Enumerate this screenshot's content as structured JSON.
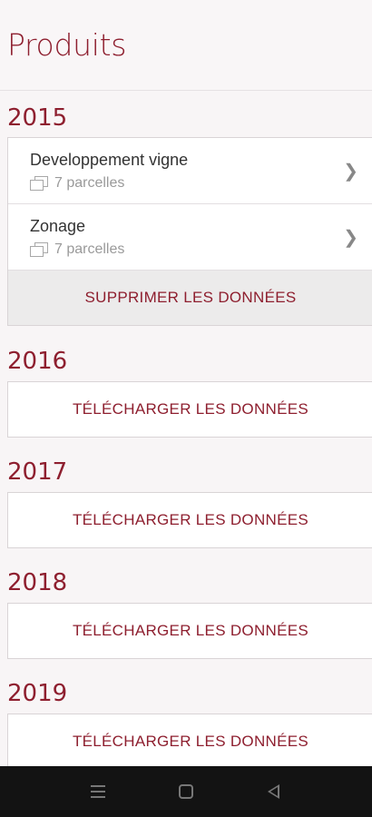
{
  "header": {
    "title": "Produits"
  },
  "years": [
    {
      "year": "2015",
      "products": [
        {
          "name": "Developpement vigne",
          "meta": "7 parcelles"
        },
        {
          "name": "Zonage",
          "meta": "7 parcelles"
        }
      ],
      "action_label": "SUPPRIMER LES DONNÉES"
    },
    {
      "year": "2016",
      "action_label": "TÉLÉCHARGER LES DONNÉES"
    },
    {
      "year": "2017",
      "action_label": "TÉLÉCHARGER LES DONNÉES"
    },
    {
      "year": "2018",
      "action_label": "TÉLÉCHARGER LES DONNÉES"
    },
    {
      "year": "2019",
      "action_label": "TÉLÉCHARGER LES DONNÉES"
    }
  ],
  "icons": {
    "parcel": "parcels-icon",
    "chevron": "chevron-right-icon",
    "nav_menu": "menu-icon",
    "nav_home": "home-icon",
    "nav_back": "back-icon"
  },
  "colors": {
    "accent": "#8e1f2f",
    "background": "#f8f5f6",
    "navbar": "#131313"
  }
}
